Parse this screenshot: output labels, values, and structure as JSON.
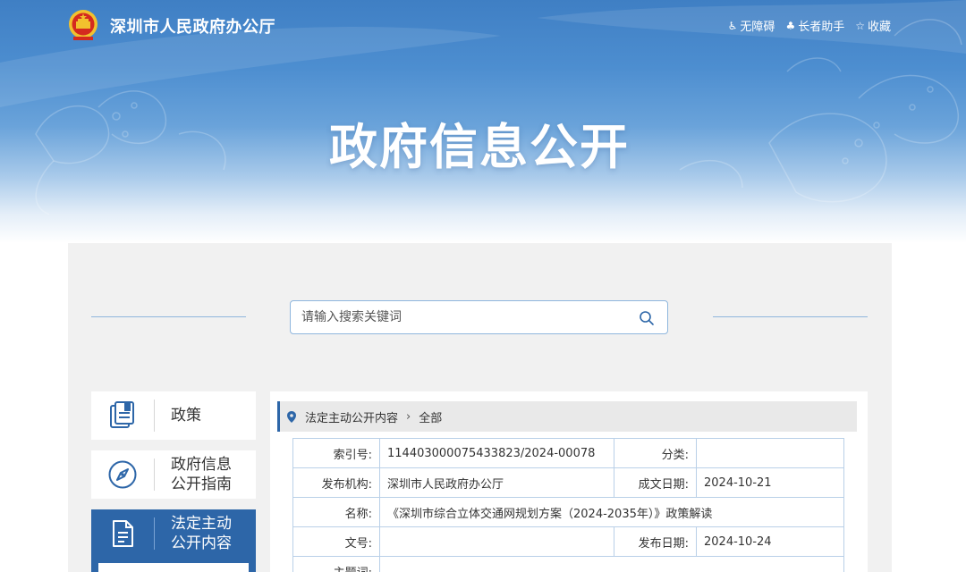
{
  "header": {
    "site_name": "深圳市人民政府办公厅",
    "hero_title": "政府信息公开",
    "tools": [
      {
        "icon": "wheelchair-icon",
        "label": "无障碍"
      },
      {
        "icon": "elder-icon",
        "label": "长者助手"
      },
      {
        "icon": "star-icon",
        "label": "收藏"
      }
    ]
  },
  "search": {
    "placeholder": "请输入搜索关键词",
    "value": ""
  },
  "sidebar": {
    "items": [
      {
        "icon": "policy-document-icon",
        "label_lines": [
          "政策"
        ],
        "active": false
      },
      {
        "icon": "compass-icon",
        "label_lines": [
          "政府信息",
          "公开指南"
        ],
        "active": false
      },
      {
        "icon": "file-list-icon",
        "label_lines": [
          "法定主动",
          "公开内容"
        ],
        "active": true
      }
    ]
  },
  "breadcrumb": {
    "items": [
      "法定主动公开内容",
      "全部"
    ]
  },
  "info_table": {
    "index_label": "索引号:",
    "index_value": "114403000075433823/2024-00078",
    "category_label": "分类:",
    "category_value": "",
    "publisher_label": "发布机构:",
    "publisher_value": "深圳市人民政府办公厅",
    "created_label": "成文日期:",
    "created_value": "2024-10-21",
    "name_label": "名称:",
    "name_value": "《深圳市综合立体交通网规划方案（2024-2035年）》政策解读",
    "docno_label": "文号:",
    "docno_value": "",
    "published_label": "发布日期:",
    "published_value": "2024-10-24",
    "topic_label": "主题词:"
  },
  "colors": {
    "primary_blue": "#2d66a8",
    "banner_blue": "#4d8ed0",
    "table_border": "#b9d0e8",
    "emblem_red": "#d42a1f",
    "emblem_gold": "#f2c12e"
  }
}
